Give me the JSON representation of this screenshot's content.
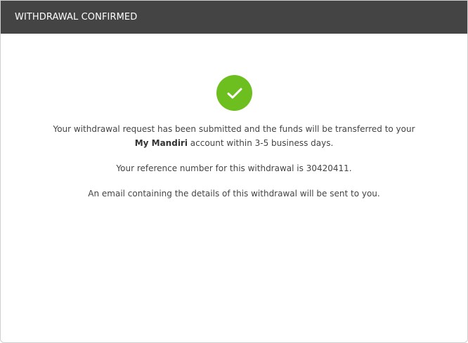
{
  "dialog": {
    "title": "WITHDRAWAL CONFIRMED"
  },
  "icon": "check-icon",
  "colors": {
    "header_bg": "#444444",
    "success_green": "#6cbf1f",
    "text": "#444444"
  },
  "message": {
    "line1": "Your withdrawal request has been submitted and the funds will be transferred to your",
    "account_name": "My Mandiri",
    "line2_suffix": " account within 3-5 business days.",
    "reference_text": "Your reference number for this withdrawal is 30420411.",
    "email_text": "An email containing the details of this withdrawal will be sent to you."
  }
}
